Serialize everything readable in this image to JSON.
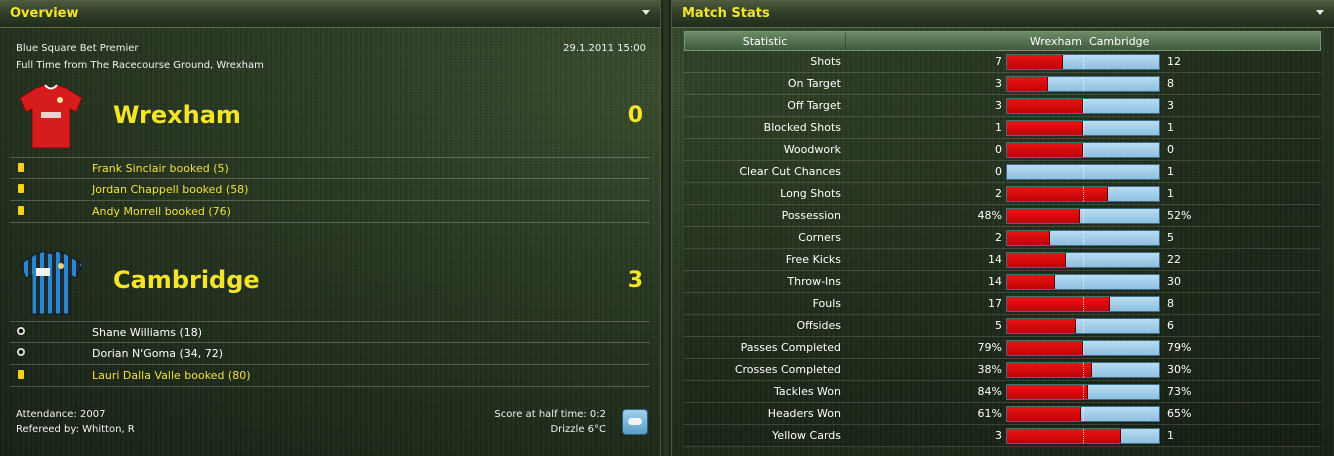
{
  "overview": {
    "title": "Overview",
    "competition": "Blue Square Bet Premier",
    "datetime": "29.1.2011 15:00",
    "venue_line": "Full Time from The Racecourse Ground, Wrexham",
    "home": {
      "name": "Wrexham",
      "score": "0",
      "kit_color": "#d41a1a",
      "events": [
        {
          "type": "yellow-card",
          "text": "Frank Sinclair booked (5)"
        },
        {
          "type": "yellow-card",
          "text": "Jordan Chappell booked (58)"
        },
        {
          "type": "yellow-card",
          "text": "Andy Morrell booked (76)"
        }
      ]
    },
    "away": {
      "name": "Cambridge",
      "score": "3",
      "kit_color": "#3a8ec4",
      "events": [
        {
          "type": "goal",
          "text": "Shane Williams (18)"
        },
        {
          "type": "goal",
          "text": "Dorian N'Goma (34, 72)"
        },
        {
          "type": "yellow-card",
          "text": "Lauri Dalla Valle booked (80)"
        }
      ]
    },
    "attendance": "Attendance: 2007",
    "referee": "Refereed by: Whitton, R",
    "halftime": "Score at half time: 0:2",
    "weather": "Drizzle 6°C"
  },
  "stats": {
    "title": "Match Stats",
    "header": {
      "statistic": "Statistic",
      "home": "Wrexham",
      "away": "Cambridge"
    },
    "colors": {
      "home": "#d41010",
      "away": "#a9d2ee"
    },
    "rows": [
      {
        "label": "Shots",
        "home": "7",
        "away": "12",
        "home_share": 0.368
      },
      {
        "label": "On Target",
        "home": "3",
        "away": "8",
        "home_share": 0.273
      },
      {
        "label": "Off Target",
        "home": "3",
        "away": "3",
        "home_share": 0.5
      },
      {
        "label": "Blocked Shots",
        "home": "1",
        "away": "1",
        "home_share": 0.5
      },
      {
        "label": "Woodwork",
        "home": "0",
        "away": "0",
        "home_share": 0.5
      },
      {
        "label": "Clear Cut Chances",
        "home": "0",
        "away": "1",
        "home_share": 0
      },
      {
        "label": "Long Shots",
        "home": "2",
        "away": "1",
        "home_share": 0.667
      },
      {
        "label": "Possession",
        "home": "48%",
        "away": "52%",
        "home_share": 0.48
      },
      {
        "label": "Corners",
        "home": "2",
        "away": "5",
        "home_share": 0.286
      },
      {
        "label": "Free Kicks",
        "home": "14",
        "away": "22",
        "home_share": 0.389
      },
      {
        "label": "Throw-Ins",
        "home": "14",
        "away": "30",
        "home_share": 0.318
      },
      {
        "label": "Fouls",
        "home": "17",
        "away": "8",
        "home_share": 0.68
      },
      {
        "label": "Offsides",
        "home": "5",
        "away": "6",
        "home_share": 0.455
      },
      {
        "label": "Passes Completed",
        "home": "79%",
        "away": "79%",
        "home_share": 0.5
      },
      {
        "label": "Crosses Completed",
        "home": "38%",
        "away": "30%",
        "home_share": 0.559
      },
      {
        "label": "Tackles Won",
        "home": "84%",
        "away": "73%",
        "home_share": 0.535
      },
      {
        "label": "Headers Won",
        "home": "61%",
        "away": "65%",
        "home_share": 0.484
      },
      {
        "label": "Yellow Cards",
        "home": "3",
        "away": "1",
        "home_share": 0.75
      }
    ]
  }
}
